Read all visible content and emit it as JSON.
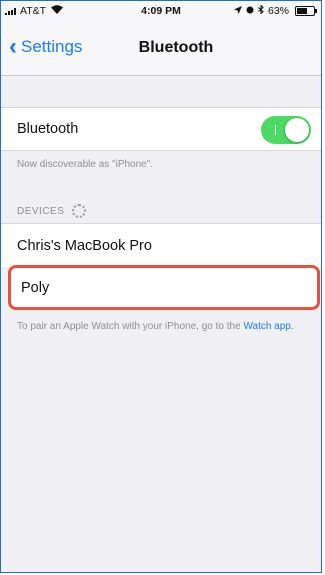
{
  "status_bar": {
    "carrier": "AT&T",
    "time": "4:09 PM",
    "battery_percent": "63%",
    "battery_level": 0.63
  },
  "nav": {
    "back_label": "Settings",
    "title": "Bluetooth"
  },
  "bluetooth": {
    "label": "Bluetooth",
    "enabled": true,
    "discoverable_note": "Now discoverable as \"iPhone\"."
  },
  "devices": {
    "header": "DEVICES",
    "items": [
      {
        "name": "Chris's MacBook Pro"
      },
      {
        "name": "Poly"
      }
    ]
  },
  "footer": {
    "text": "To pair an Apple Watch with your iPhone, go to the",
    "link": "Watch app."
  },
  "colors": {
    "accent": "#1a7cf2",
    "toggle_on": "#4cd964",
    "highlight": "#e5533f"
  }
}
